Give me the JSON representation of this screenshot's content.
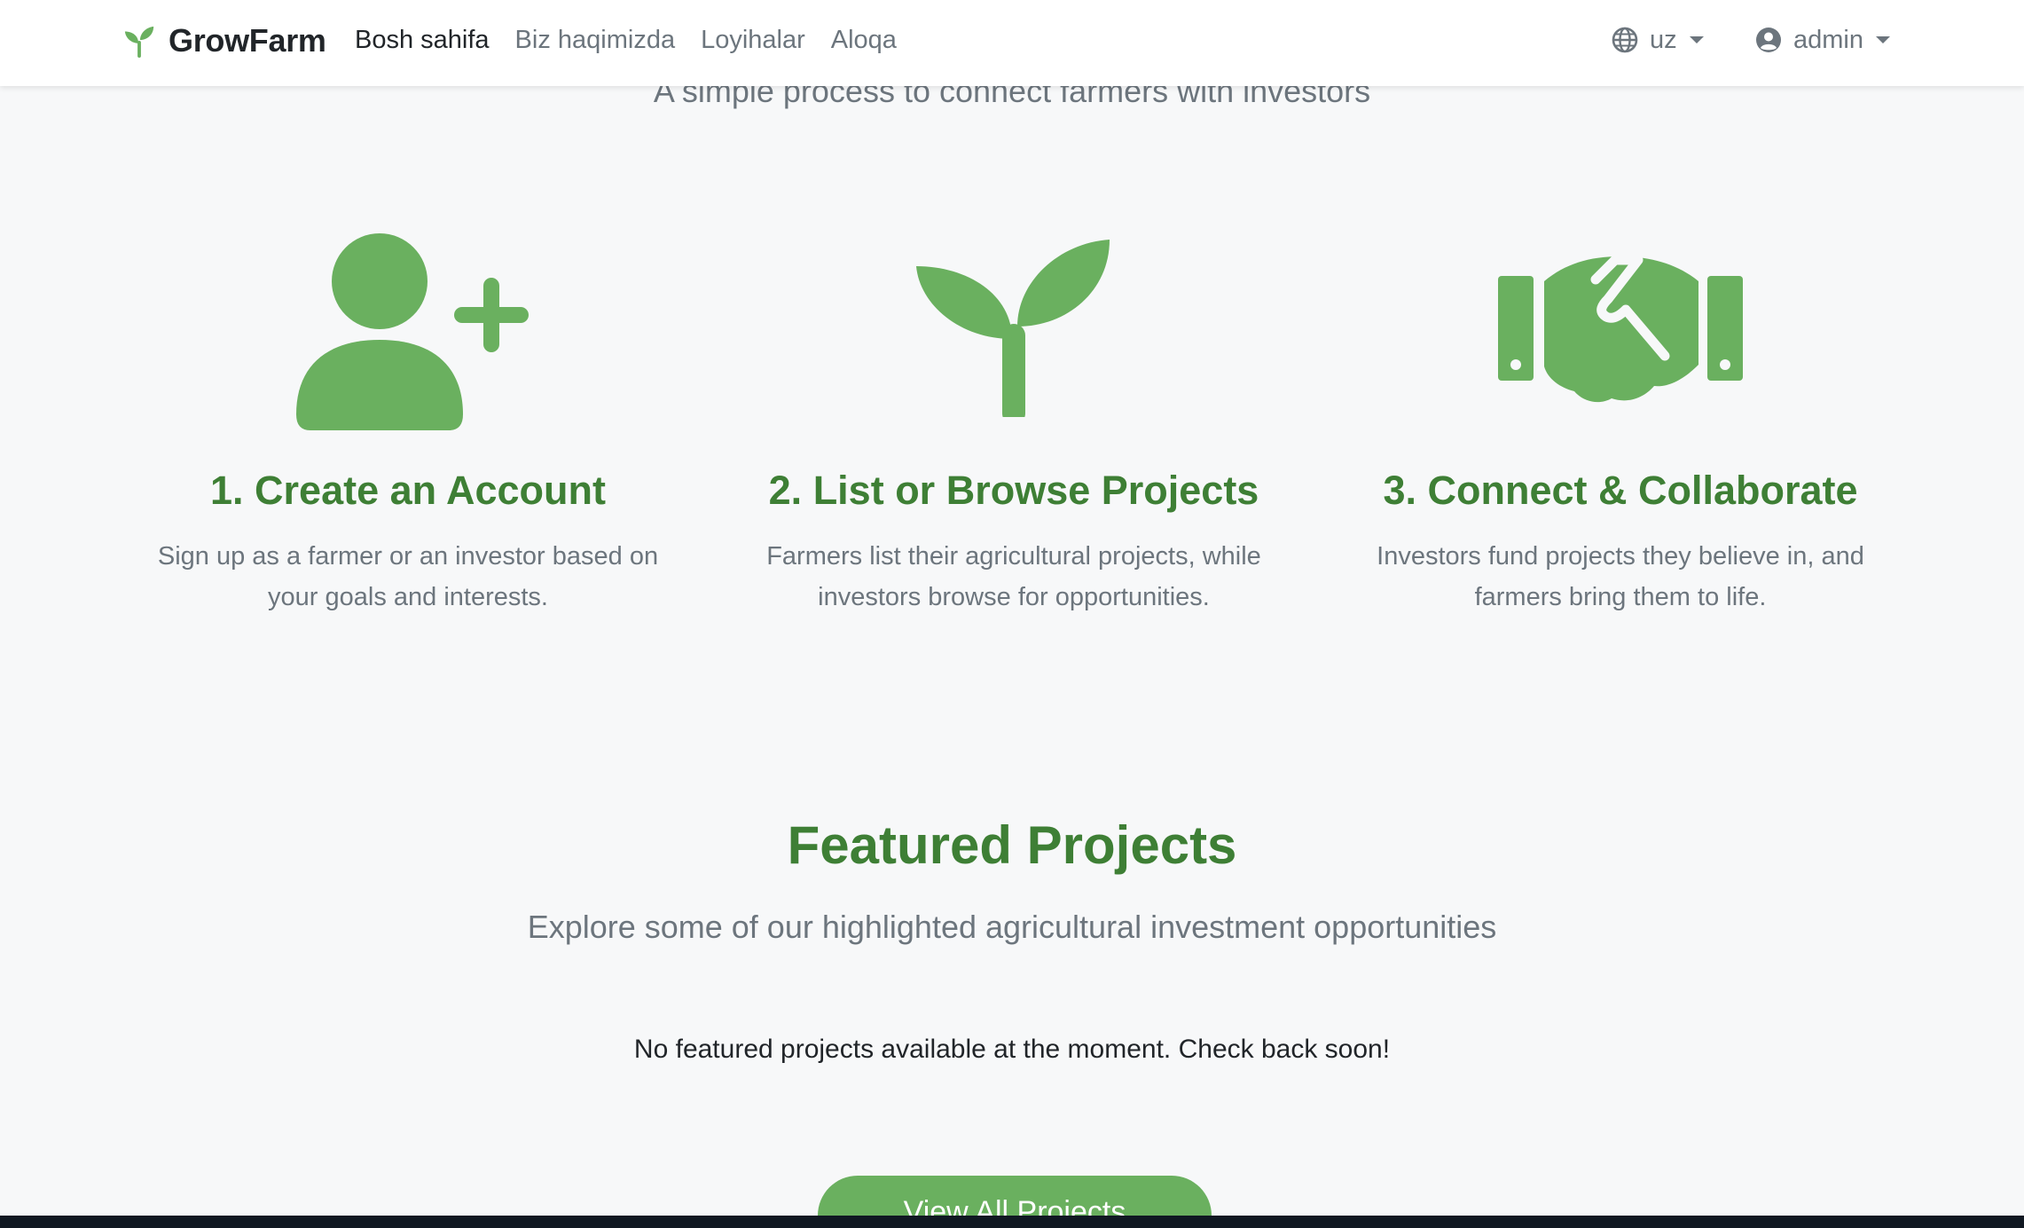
{
  "navbar": {
    "brand": "GrowFarm",
    "links": [
      "Bosh sahifa",
      "Biz haqimizda",
      "Loyihalar",
      "Aloqa"
    ],
    "language": "uz",
    "user": "admin"
  },
  "how_it_works": {
    "subtitle": "A simple process to connect farmers with investors",
    "steps": [
      {
        "icon": "user-plus-icon",
        "title": "1. Create an Account",
        "description": "Sign up as a farmer or an investor based on your goals and interests."
      },
      {
        "icon": "seedling-icon",
        "title": "2. List or Browse Projects",
        "description": "Farmers list their agricultural projects, while investors browse for opportunities."
      },
      {
        "icon": "handshake-icon",
        "title": "3. Connect & Collaborate",
        "description": "Investors fund projects they believe in, and farmers bring them to life."
      }
    ]
  },
  "featured": {
    "title": "Featured Projects",
    "subtitle": "Explore some of our highlighted agricultural investment opportunities",
    "empty_message": "No featured projects available at the moment. Check back soon!",
    "view_all_label": "View All Projects"
  },
  "colors": {
    "brand_green": "#6ab05f",
    "heading_green": "#3e7f35",
    "muted_text": "#6c757d"
  }
}
